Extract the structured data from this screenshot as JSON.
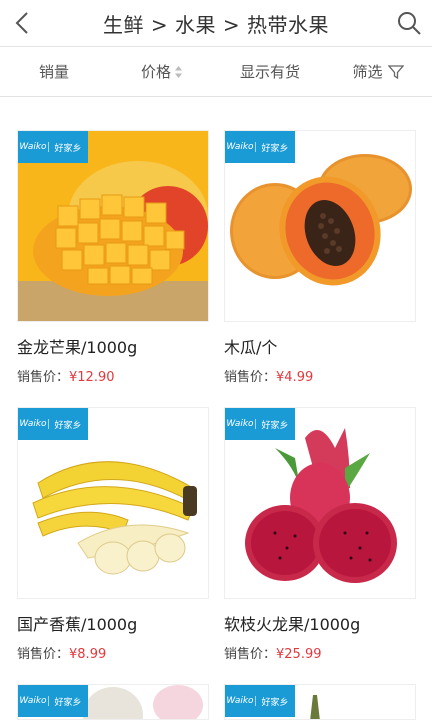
{
  "header": {
    "title": "生鲜 > 水果 > 热带水果"
  },
  "sortbar": {
    "items": [
      {
        "label": "销量"
      },
      {
        "label": "价格"
      },
      {
        "label": "显示有货"
      },
      {
        "label": "筛选"
      }
    ]
  },
  "badge": {
    "brand1": "Waiko",
    "brand2": "好家乡"
  },
  "products": [
    {
      "name": "金龙芒果/1000g",
      "price_label": "销售价：",
      "price": "¥12.90"
    },
    {
      "name": "木瓜/个",
      "price_label": "销售价：",
      "price": "¥4.99"
    },
    {
      "name": "国产香蕉/1000g",
      "price_label": "销售价：",
      "price": "¥8.99"
    },
    {
      "name": "软枝火龙果/1000g",
      "price_label": "销售价：",
      "price": "¥25.99"
    }
  ],
  "colors": {
    "badge_blue": "#1a9bd6",
    "price_red": "#e0393e"
  }
}
